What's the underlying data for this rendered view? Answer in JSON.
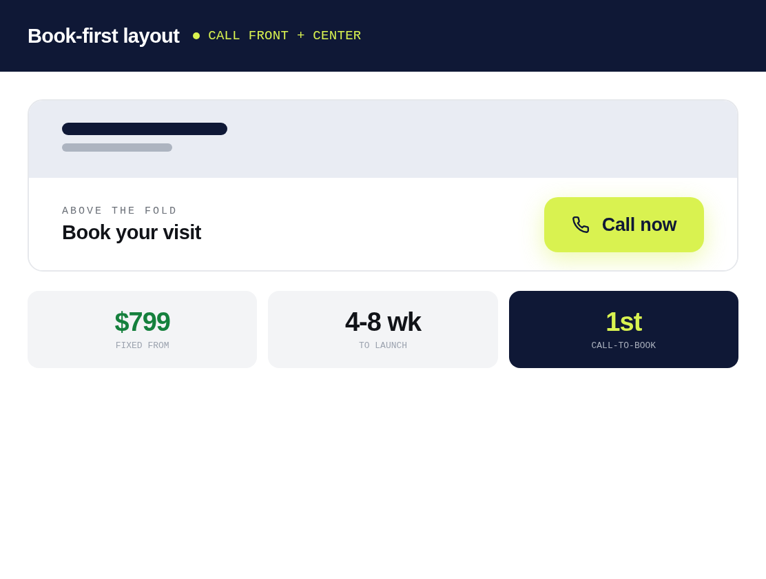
{
  "header": {
    "title": "Book-first layout",
    "tagline": "CALL FRONT + CENTER"
  },
  "hero": {
    "eyebrow": "ABOVE THE FOLD",
    "heading": "Book your visit",
    "button": "Call now"
  },
  "stats": [
    {
      "kind": "price",
      "value": "$799",
      "label": "FIXED FROM"
    },
    {
      "kind": "plain",
      "value": "4-8 wk",
      "label": "TO LAUNCH"
    },
    {
      "kind": "featured",
      "value": "1st",
      "label": "CALL-TO-BOOK"
    }
  ]
}
